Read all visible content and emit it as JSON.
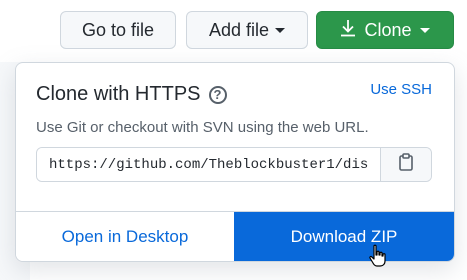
{
  "header": {
    "go_to_file_label": "Go to file",
    "add_file_label": "Add file",
    "clone_label": "Clone"
  },
  "clone_popover": {
    "title": "Clone with HTTPS",
    "use_ssh_label": "Use SSH",
    "description": "Use Git or checkout with SVN using the web URL.",
    "url_value": "https://github.com/Theblockbuster1/dis",
    "open_desktop_label": "Open in Desktop",
    "download_zip_label": "Download ZIP"
  },
  "colors": {
    "clone_green": "#2c974b",
    "link_blue": "#0969da",
    "download_blue": "#0969da"
  },
  "icons": {
    "download": "download-icon",
    "help": "question-circle-icon",
    "clipboard": "clipboard-icon",
    "cursor": "hand-pointer-cursor"
  }
}
